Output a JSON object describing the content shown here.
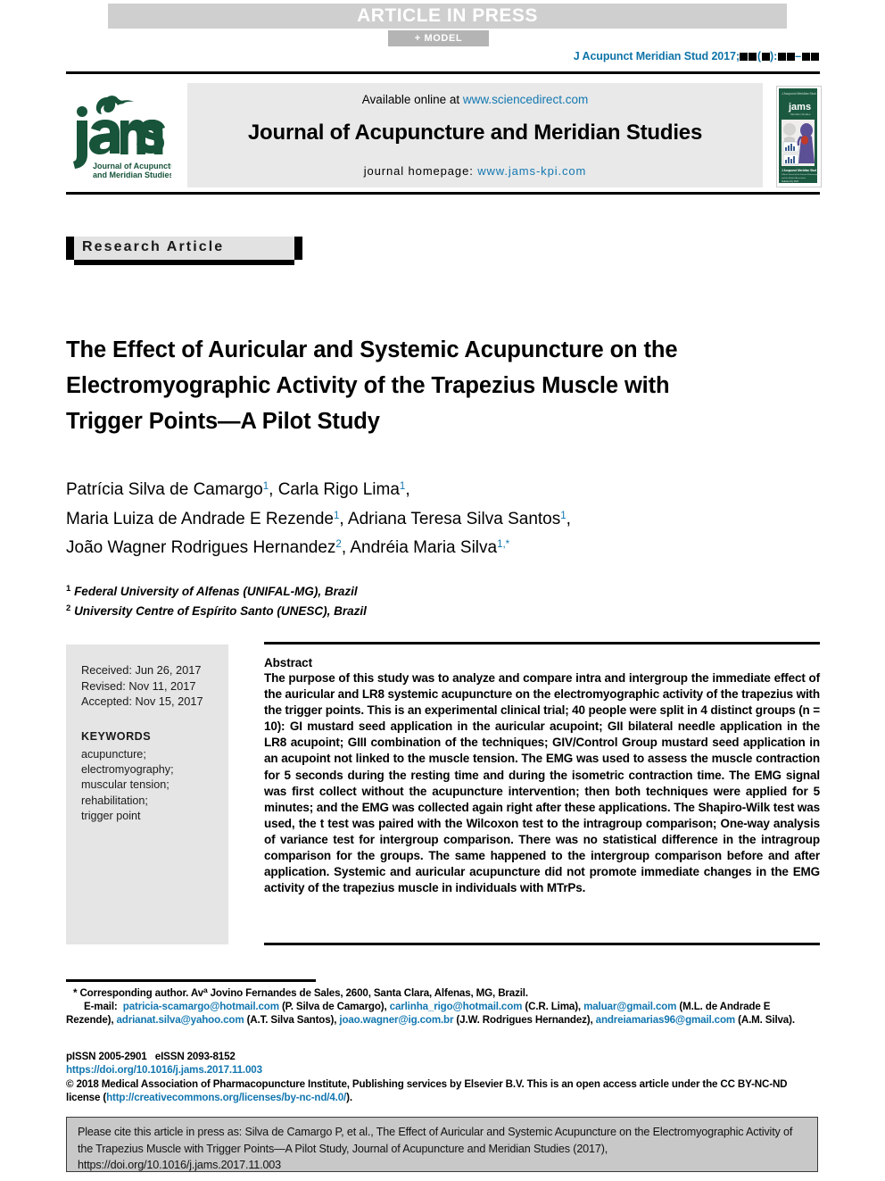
{
  "banner": {
    "press": "ARTICLE IN PRESS",
    "model": "+ MODEL"
  },
  "journal_ref": {
    "prefix": "J Acupunct Meridian Stud 2017;",
    "volume_placeholder": "■■",
    "issue_open": "(",
    "issue_placeholder": "■",
    "issue_close": "):",
    "pages_start": "■■",
    "dash": "–",
    "pages_end": "■■"
  },
  "masthead": {
    "available_label": "Available online at",
    "sciencedirect_url": "www.sciencedirect.com",
    "journal_name": "Journal of Acupuncture and Meridian Studies",
    "homepage_label": "journal homepage:",
    "homepage_url": "www.jams-kpi.com",
    "logo_text": "jams",
    "logo_subtitle_line1": "Journal of Acupuncture",
    "logo_subtitle_line2": "and Meridian Studies",
    "logo_color": "#17543a",
    "cover_alt": "journal-cover-thumbnail"
  },
  "badge": {
    "label": "Research Article"
  },
  "article": {
    "title": "The Effect of Auricular and Systemic Acupuncture on the Electromyographic Activity of the Trapezius Muscle with Trigger Points—A Pilot Study",
    "authors": [
      {
        "name": "Patrícia Silva de Camargo",
        "sup": "1",
        "sep": ", "
      },
      {
        "name": "Carla Rigo Lima",
        "sup": "1",
        "sep": ","
      },
      {
        "name": "Maria Luiza de Andrade E Rezende",
        "sup": "1",
        "sep": ", "
      },
      {
        "name": "Adriana Teresa Silva Santos",
        "sup": "1",
        "sep": ","
      },
      {
        "name": "João Wagner Rodrigues Hernandez",
        "sup": "2",
        "sep": ", "
      },
      {
        "name": "Andréia Maria Silva",
        "sup": "1,*",
        "sep": ""
      }
    ],
    "affiliations": [
      {
        "marker": "1",
        "text": "Federal University of Alfenas (UNIFAL-MG), Brazil"
      },
      {
        "marker": "2",
        "text": "University Centre of Espírito Santo (UNESC), Brazil"
      }
    ]
  },
  "meta": {
    "received": "Received: Jun 26, 2017",
    "revised": "Revised: Nov 11, 2017",
    "accepted": "Accepted: Nov 15, 2017",
    "keywords_heading": "KEYWORDS",
    "keywords": "acupuncture;\nelectromyography;\nmuscular tension;\nrehabilitation;\ntrigger point"
  },
  "abstract": {
    "heading": "Abstract",
    "body": "The purpose of this study was to analyze and compare intra and intergroup the immediate effect of the auricular and LR8 systemic acupuncture on the electromyographic activity of the trapezius with the trigger points. This is an experimental clinical trial; 40 people were split in 4 distinct groups (n = 10): GI mustard seed application in the auricular acupoint; GII bilateral needle application in the LR8 acupoint; GIII combination of the techniques; GIV/Control Group mustard seed application in an acupoint not linked to the muscle tension. The EMG was used to assess the muscle contraction for 5 seconds during the resting time and during the isometric contraction time. The EMG signal was first collect without the acupuncture intervention; then both techniques were applied for 5 minutes; and the EMG was collected again right after these applications. The Shapiro-Wilk test was used, the t test was paired with the Wilcoxon test to the intragroup comparison; One-way analysis of variance test for intergroup comparison. There was no statistical difference in the intragroup comparison for the groups. The same happened to the intergroup comparison before and after application. Systemic and auricular acupuncture did not promote immediate changes in the EMG activity of the trapezius muscle in individuals with MTrPs."
  },
  "footnotes": {
    "corresponding_marker": "*",
    "corresponding_text": " Corresponding author. Av",
    "corresponding_sup": "a",
    "corresponding_rest": " Jovino Fernandes de Sales, 2600, Santa Clara, Alfenas, MG, Brazil.",
    "email_label": "E-mail:",
    "emails": [
      {
        "address": "patricia-scamargo@hotmail.com",
        "owner": " (P. Silva de Camargo), "
      },
      {
        "address": "carlinha_rigo@hotmail.com",
        "owner": " (C.R. Lima), "
      },
      {
        "address": "maluar@gmail.com",
        "owner": " (M.L. de Andrade E Rezende), "
      },
      {
        "address": "adrianat.silva@yahoo.com",
        "owner": " (A.T. Silva Santos), "
      },
      {
        "address": "joao.wagner@ig.com.br",
        "owner": " (J.W. Rodrigues Hernandez), "
      },
      {
        "address": "andreiamarias96@gmail.com",
        "owner": " (A.M. Silva)."
      }
    ]
  },
  "issn": {
    "pissn": "pISSN 2005-2901",
    "eissn": "eISSN 2093-8152",
    "doi": "https://doi.org/10.1016/j.jams.2017.11.003",
    "copyright_pre": "© 2018 Medical Association of Pharmacopuncture Institute, Publishing services by Elsevier B.V. This is an open access article under the CC BY-NC-ND license (",
    "license_url": "http://creativecommons.org/licenses/by-nc-nd/4.0/",
    "copyright_post": ")."
  },
  "citation": {
    "text": "Please cite this article in press as: Silva de Camargo P, et al., The Effect of Auricular and Systemic Acupuncture on the Electromyographic Activity of the Trapezius Muscle with Trigger Points—A Pilot Study, Journal of Acupuncture and Meridian Studies (2017), https://doi.org/10.1016/j.jams.2017.11.003"
  },
  "colors": {
    "link_blue": "#1277b0",
    "ref_blue": "#0f74a8",
    "band_grey": "#cfcfcf",
    "model_grey": "#b4b4b4",
    "masthead_grey": "#e9e9e9",
    "meta_grey": "#e5e5e5",
    "cite_grey": "#c8c8c8",
    "logo_green": "#17543a"
  }
}
